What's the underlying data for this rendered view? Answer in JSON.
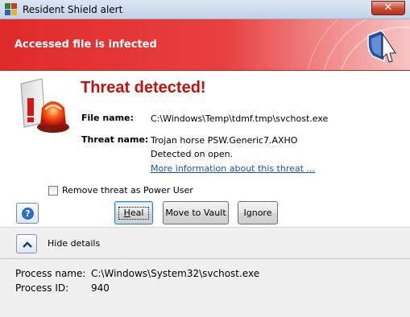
{
  "window": {
    "title": "Resident Shield alert",
    "close_glyph": "✕"
  },
  "banner": {
    "title": "Accessed file is infected",
    "logo_icon": "shield-logo-icon"
  },
  "threat": {
    "heading": "Threat detected!",
    "file_name_label": "File name:",
    "file_name": "C:\\Windows\\Temp\\tdmf.tmp\\svchost.exe",
    "threat_name_label": "Threat name:",
    "threat_name": "Trojan horse PSW.Generic7.AXHO",
    "detected_text": "Detected on open.",
    "more_info_link": "More information about this threat ..."
  },
  "options": {
    "remove_power_user_label": "Remove threat as Power User",
    "remove_power_user_checked": false
  },
  "buttons": {
    "help_glyph": "?",
    "heal": "Heal",
    "move_to_vault": "Move to Vault",
    "ignore": "Ignore"
  },
  "details_toggle": {
    "label": "Hide details"
  },
  "details": {
    "process_name_label": "Process name:",
    "process_name": "C:\\Windows\\System32\\svchost.exe",
    "process_id_label": "Process ID:",
    "process_id": "940"
  },
  "colors": {
    "banner_red": "#e02a2a",
    "heading_red": "#c01010",
    "link_blue": "#1f4fbf"
  }
}
